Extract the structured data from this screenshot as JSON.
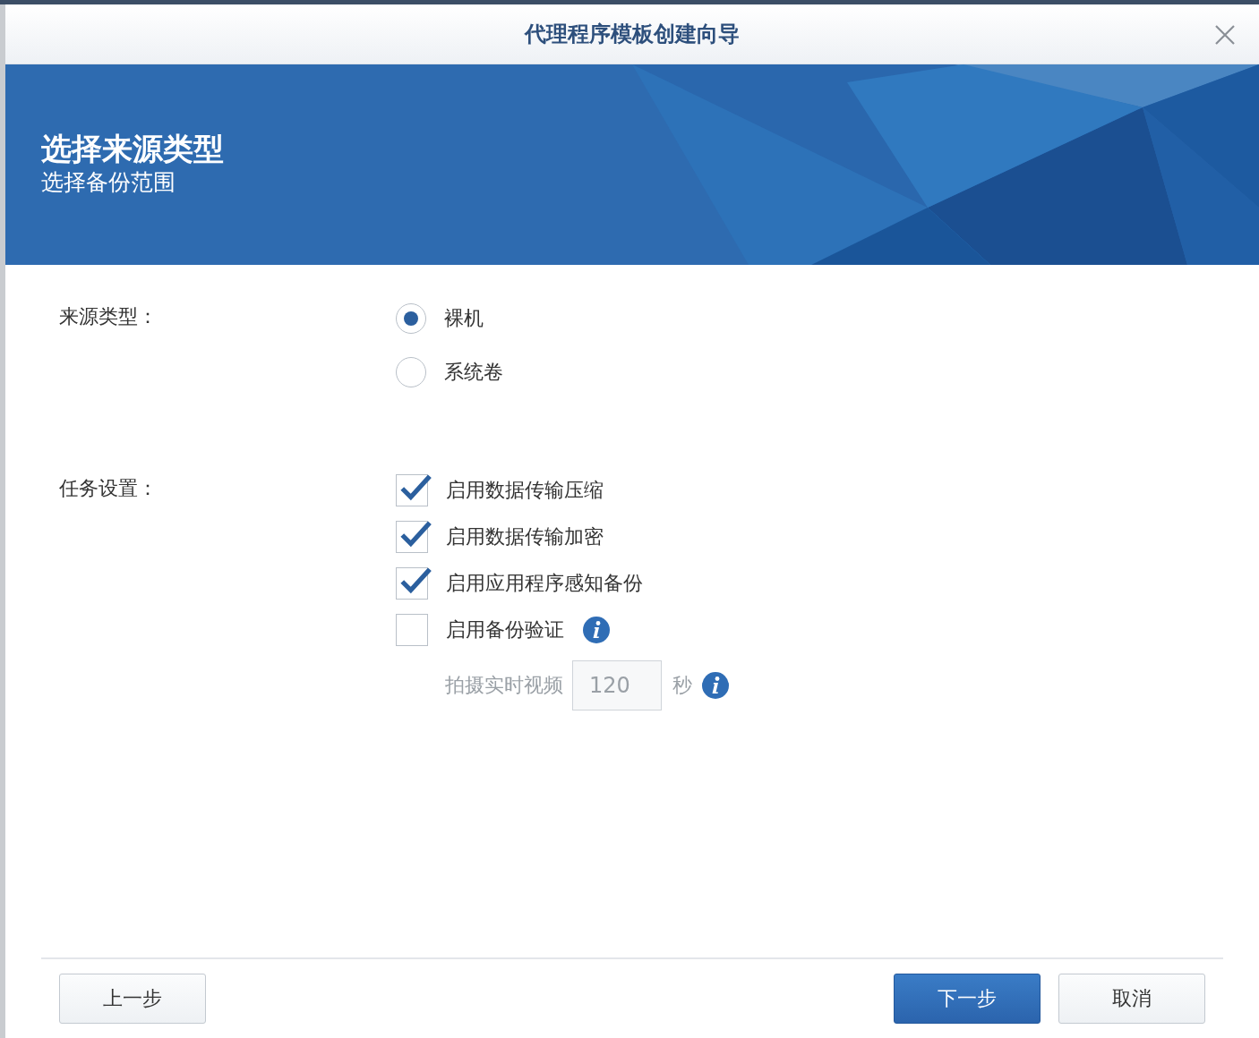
{
  "window": {
    "title": "代理程序模板创建向导"
  },
  "banner": {
    "title": "选择来源类型",
    "subtitle": "选择备份范围"
  },
  "source_type": {
    "label": "来源类型：",
    "options": [
      {
        "label": "裸机",
        "selected": true
      },
      {
        "label": "系统卷",
        "selected": false
      }
    ]
  },
  "task_settings": {
    "label": "任务设置：",
    "options": [
      {
        "label": "启用数据传输压缩",
        "checked": true,
        "info": false
      },
      {
        "label": "启用数据传输加密",
        "checked": true,
        "info": false
      },
      {
        "label": "启用应用程序感知备份",
        "checked": true,
        "info": false
      },
      {
        "label": "启用备份验证",
        "checked": false,
        "info": true
      }
    ],
    "snapshot": {
      "label": "拍摄实时视频",
      "value": "120",
      "unit": "秒",
      "disabled": true,
      "info": true
    }
  },
  "buttons": [
    {
      "label": "上一步",
      "kind": "secondary"
    },
    {
      "label": "下一步",
      "kind": "primary"
    },
    {
      "label": "取消",
      "kind": "secondary"
    }
  ]
}
